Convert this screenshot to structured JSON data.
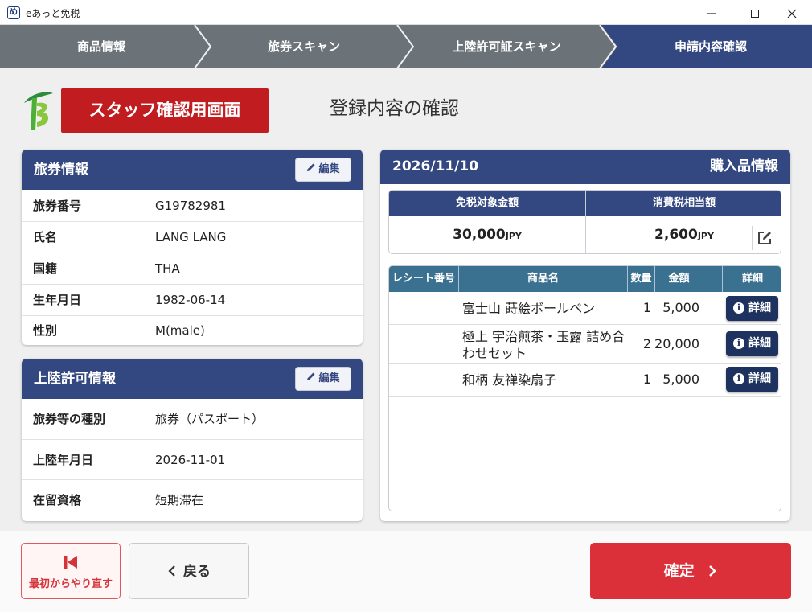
{
  "window": {
    "app_title": "eあっと免税",
    "icon_glyph": "め"
  },
  "steps": [
    {
      "label": "商品情報",
      "active": false
    },
    {
      "label": "旅券スキャン",
      "active": false
    },
    {
      "label": "上陸許可証スキャン",
      "active": false
    },
    {
      "label": "申請内容確認",
      "active": true
    }
  ],
  "colors": {
    "step_inactive": "#6b7278",
    "step_active": "#334780",
    "card_header": "#334780",
    "banner_red": "#c11c20",
    "confirm_red": "#db3039",
    "table_header": "#3a7190"
  },
  "header": {
    "staff_banner": "スタッフ確認用画面",
    "page_title": "登録内容の確認"
  },
  "passport": {
    "title": "旅券情報",
    "edit_label": "編集",
    "rows": [
      {
        "key": "旅券番号",
        "value": "G19782981"
      },
      {
        "key": "氏名",
        "value": "LANG LANG"
      },
      {
        "key": "国籍",
        "value": "THA"
      },
      {
        "key": "生年月日",
        "value": "1982-06-14"
      },
      {
        "key": "性別",
        "value": "M(male)"
      }
    ]
  },
  "landing": {
    "title": "上陸許可情報",
    "edit_label": "編集",
    "rows": [
      {
        "key": "旅券等の種別",
        "value": "旅券（パスポート）"
      },
      {
        "key": "上陸年月日",
        "value": "2026-11-01"
      },
      {
        "key": "在留資格",
        "value": "短期滞在"
      }
    ]
  },
  "purchase": {
    "date": "2026/11/10",
    "title": "購入品情報",
    "summary": {
      "taxfree_label": "免税対象金額",
      "taxfree_value": "30,000",
      "tax_label": "消費税相当額",
      "tax_value": "2,600",
      "currency": "JPY"
    },
    "columns": [
      "レシート番号",
      "商品名",
      "数量",
      "金額",
      "",
      "詳細"
    ],
    "items": [
      {
        "receipt": "",
        "name": "富士山 蒔絵ボールペン",
        "qty": "1",
        "amount": "5,000",
        "detail_label": "詳細"
      },
      {
        "receipt": "",
        "name": "極上 宇治煎茶・玉露 詰め合わせセット",
        "qty": "2",
        "amount": "20,000",
        "detail_label": "詳細"
      },
      {
        "receipt": "",
        "name": "和柄 友禅染扇子",
        "qty": "1",
        "amount": "5,000",
        "detail_label": "詳細"
      }
    ]
  },
  "footer": {
    "restart_label": "最初からやり直す",
    "back_label": "戻る",
    "confirm_label": "確定"
  }
}
